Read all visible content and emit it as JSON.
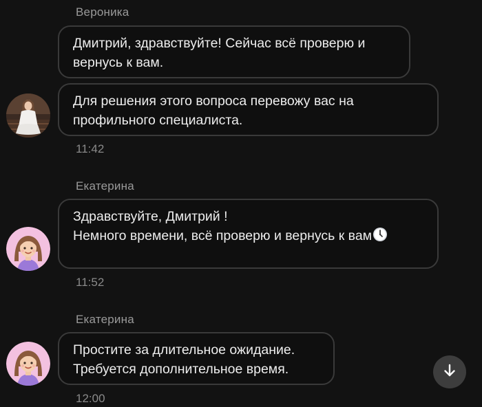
{
  "messages": [
    {
      "sender": "Вероника",
      "bubbles": [
        [
          "Дмитрий, здравствуйте! Сейчас всё проверю и",
          "вернусь к вам."
        ],
        [
          "Для решения этого вопроса перевожу вас на",
          "профильного специалиста."
        ]
      ],
      "time": "11:42",
      "avatar": "photo-avatar"
    },
    {
      "sender": "Екатерина",
      "bubbles": [
        [
          "Здравствуйте, Дмитрий !",
          "Немного времени, всё проверю и вернусь к вам"
        ]
      ],
      "time": "11:52",
      "avatar": "girl-emoji-avatar",
      "emoji": "clock-icon"
    },
    {
      "sender": "Екатерина",
      "bubbles": [
        [
          "Простите за длительное ожидание.",
          "Требуется дополнительное время."
        ]
      ],
      "time": "12:00",
      "avatar": "girl-emoji-avatar"
    }
  ],
  "scroll_button": {
    "icon": "arrow-down-icon"
  },
  "colors": {
    "background": "#121212",
    "bubble_border": "#3a3a3a",
    "meta_text": "#9a9a9a",
    "avatar_bg": "#f3c1e0"
  }
}
